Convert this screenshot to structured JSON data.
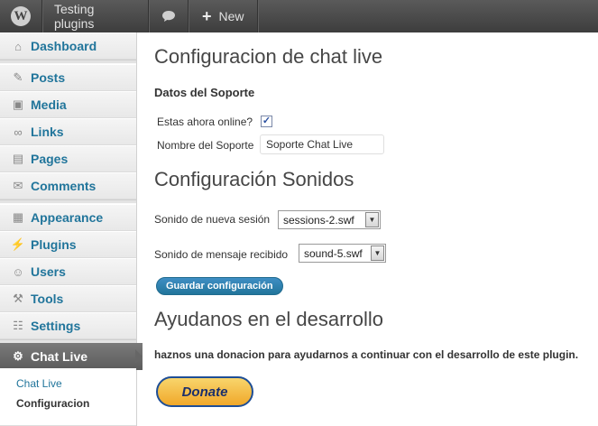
{
  "adminbar": {
    "site_name": "Testing plugins",
    "new_label": "New",
    "logo_glyph": "W"
  },
  "sidebar": {
    "items": [
      {
        "label": "Dashboard",
        "icon": "dashboard-icon",
        "glyph": "⌂"
      },
      {
        "label": "Posts",
        "icon": "pin-icon",
        "glyph": "✎"
      },
      {
        "label": "Media",
        "icon": "media-icon",
        "glyph": "▣"
      },
      {
        "label": "Links",
        "icon": "link-icon",
        "glyph": "∞"
      },
      {
        "label": "Pages",
        "icon": "pages-icon",
        "glyph": "▤"
      },
      {
        "label": "Comments",
        "icon": "comment-icon",
        "glyph": "✉"
      },
      {
        "label": "Appearance",
        "icon": "appearance-icon",
        "glyph": "▦"
      },
      {
        "label": "Plugins",
        "icon": "plugins-icon",
        "glyph": "⚡"
      },
      {
        "label": "Users",
        "icon": "users-icon",
        "glyph": "☺"
      },
      {
        "label": "Tools",
        "icon": "tools-icon",
        "glyph": "⚒"
      },
      {
        "label": "Settings",
        "icon": "settings-icon",
        "glyph": "☷"
      }
    ],
    "active": {
      "label": "Chat Live",
      "icon": "gear-icon",
      "glyph": "⚙"
    },
    "submenu": [
      {
        "label": "Chat Live"
      },
      {
        "label": "Configuracion"
      }
    ]
  },
  "main": {
    "title": "Configuracion de chat live",
    "section_support": "Datos del Soporte",
    "online_label": "Estas ahora online?",
    "online_checked": "✓",
    "support_name_label": "Nombre del Soporte",
    "support_name_value": "Soporte Chat Live",
    "sounds_title": "Configuración Sonidos",
    "new_session_label": "Sonido de nueva sesión",
    "new_session_value": "sessions-2.swf",
    "message_label": "Sonido de mensaje recibido",
    "message_value": "sound-5.swf",
    "save_button": "Guardar configuración",
    "help_title": "Ayudanos en el desarrollo",
    "help_text": "haznos una donacion para ayudarnos a continuar con el desarrollo de este plugin.",
    "donate_label": "Donate"
  },
  "colors": {
    "link": "#21759b",
    "adminbar": "#464646",
    "primary_button": "#21759b",
    "donate": "#f0a82a"
  }
}
